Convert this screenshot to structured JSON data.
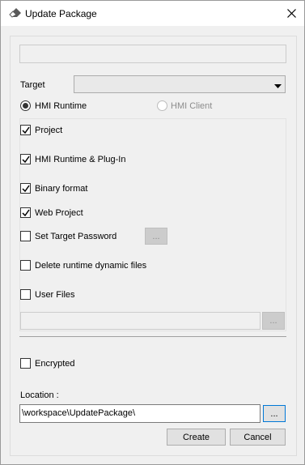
{
  "window": {
    "title": "Update Package"
  },
  "target": {
    "label": "Target",
    "selected": ""
  },
  "runtime": {
    "hmi_runtime": "HMI Runtime",
    "hmi_client": "HMI Client"
  },
  "options": [
    {
      "label": "Project",
      "checked": true
    },
    {
      "label": "HMI Runtime & Plug-In",
      "checked": true
    },
    {
      "label": "Binary format",
      "checked": true
    },
    {
      "label": "Web Project",
      "checked": true
    },
    {
      "label": "Set Target Password",
      "checked": false
    },
    {
      "label": "Delete runtime dynamic files",
      "checked": false
    },
    {
      "label": "User Files",
      "checked": false
    }
  ],
  "browse_label": "...",
  "encrypted": {
    "label": "Encrypted",
    "checked": false
  },
  "location": {
    "label": "Location :",
    "value": "\\workspace\\UpdatePackage\\"
  },
  "buttons": {
    "create": "Create",
    "cancel": "Cancel"
  },
  "icons": {
    "app": "eraser-icon",
    "close": "close-icon",
    "dropdown": "chevron-down-icon",
    "check": "checkmark-icon"
  }
}
